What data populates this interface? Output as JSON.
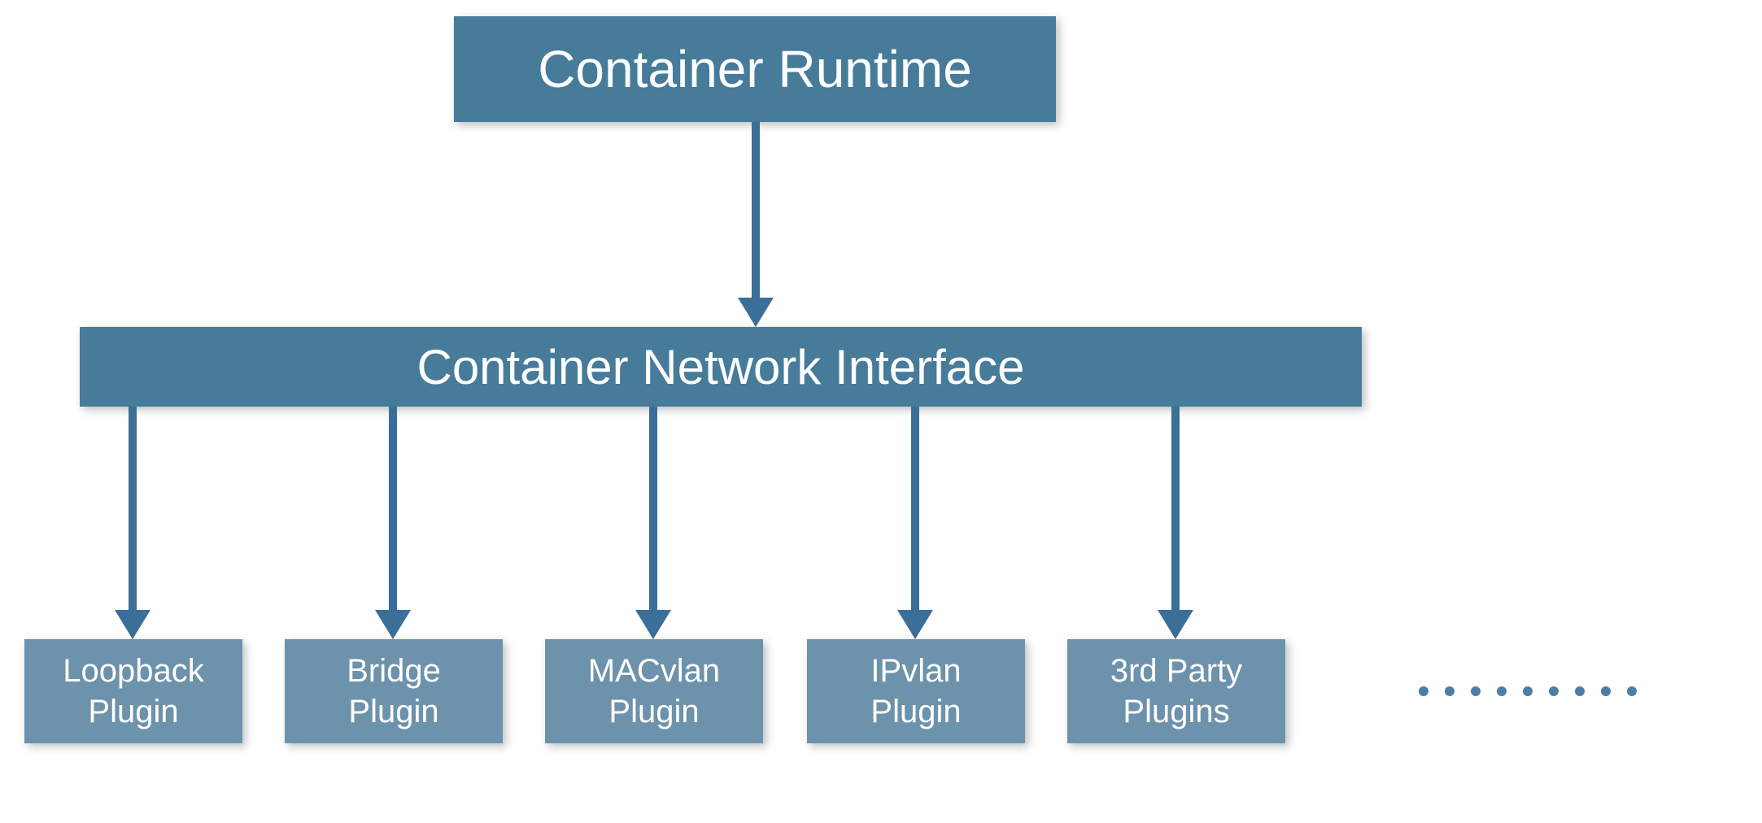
{
  "diagram": {
    "top_box": "Container Runtime",
    "middle_box": "Container Network Interface",
    "plugins": [
      "Loopback\nPlugin",
      "Bridge\nPlugin",
      "MACvlan\nPlugin",
      "IPvlan\nPlugin",
      "3rd Party\nPlugins"
    ],
    "colors": {
      "main_box": "#467b99",
      "plugin_box": "#6d92ab",
      "arrow": "#3c6e9a",
      "dot": "#4a7ea8"
    }
  }
}
